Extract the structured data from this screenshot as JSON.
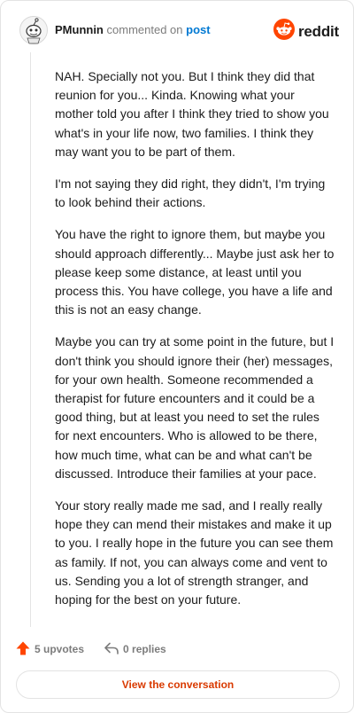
{
  "header": {
    "username": "PMunnin",
    "action_text": "commented on",
    "post_link": "post",
    "brand": "reddit"
  },
  "comment": {
    "paragraphs": [
      "NAH. Specially not you. But I think they did that reunion for you... Kinda. Knowing what your mother told you after I think they tried to show you what's in your life now, two families. I think they may want you to be part of them.",
      "I'm not saying they did right, they didn't, I'm trying to look behind their actions.",
      "You have the right to ignore them, but maybe you should approach differently... Maybe just ask her to please keep some distance, at least until you process this. You have college, you have a life and this is not an easy change.",
      "Maybe you can try at some point in the future, but I don't think you should ignore their (her) messages, for your own health. Someone recommended a therapist for future encounters and it could be a good thing, but at least you need to set the rules for next encounters. Who is allowed to be there, how much time, what can be and what can't be discussed. Introduce their families at your pace.",
      "Your story really made me sad, and I really really hope they can mend their mistakes and make it up to you. I really hope in the future you can see them as family. If not, you can always come and vent to us. Sending you a lot of strength stranger, and hoping for the best on your future."
    ]
  },
  "footer": {
    "upvotes": "5 upvotes",
    "replies": "0 replies",
    "cta_label": "View the conversation"
  },
  "colors": {
    "brand_orange": "#ff4500",
    "link_blue": "#0079d3",
    "cta_text": "#d93a00"
  },
  "icons": {
    "avatar": "snoo-avatar-icon",
    "logo": "reddit-logo-icon",
    "upvote": "upvote-arrow-icon",
    "reply": "reply-arrow-icon"
  }
}
